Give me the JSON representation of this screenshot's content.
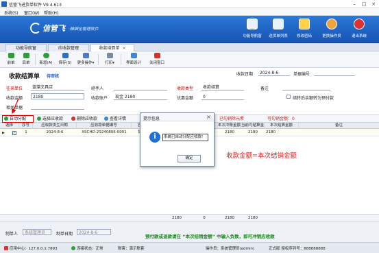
{
  "app": {
    "title": "信管飞进货单软件 V9.4.613",
    "window_controls": [
      "–",
      "□",
      "×"
    ]
  },
  "menu": [
    "系统(S)",
    "窗口(W)",
    "帮助(H)"
  ],
  "banner": {
    "brand": "信管飞",
    "slogan": "·精细化管理软件",
    "buttons": [
      {
        "label": "功能导航窗",
        "icon": "monitor-icon"
      },
      {
        "label": "送货单列表",
        "icon": "list-icon"
      },
      {
        "label": "修改密码",
        "icon": "lock-icon"
      },
      {
        "label": "更换操作员",
        "icon": "user-icon"
      },
      {
        "label": "退出系统",
        "icon": "exit-icon"
      }
    ],
    "colors": {
      "banner": "#1f66c9",
      "exit": "#e03030",
      "slogan": "#d9f0ff"
    }
  },
  "tabs": [
    {
      "label": "功能导航窗",
      "active": false
    },
    {
      "label": "应收款管理",
      "active": false
    },
    {
      "label": "收款结算单",
      "active": true,
      "close": "×"
    }
  ],
  "toolbar": [
    {
      "label": "前单",
      "icon": "arrow-left-icon"
    },
    {
      "label": "后单",
      "icon": "arrow-right-icon"
    },
    {
      "label": "新增(A)",
      "icon": "add-icon"
    },
    {
      "label": "保存(S)",
      "icon": "save-icon"
    },
    {
      "label": "更多操作",
      "icon": "more-icon",
      "dropdown": "▾"
    },
    {
      "label": "打印",
      "icon": "print-icon",
      "dropdown": "▾"
    },
    {
      "label": "界面设计",
      "icon": "design-icon"
    },
    {
      "label": "关闭窗口",
      "icon": "close-window-icon"
    }
  ],
  "form": {
    "title": "收款结算单",
    "status": "待审核",
    "date_label": "收款日期",
    "date_value": "2024-8-6",
    "docno_label": "单据编号",
    "docno_value": "",
    "customer_label": "往来单位",
    "customer_value": "蓝藻文具店",
    "handler_label": "经手人",
    "handler_value": "",
    "type_label": "收款类型",
    "type_value": "收款结算",
    "note_label": "备注",
    "note_value": "",
    "amount_label": "收款金额",
    "amount_value": "2180",
    "account_label": "收款账户",
    "account_value": "现金 2180",
    "discount_label": "优惠金额",
    "discount_value": "0",
    "checkbox_label": "结转后余额转为预付款",
    "attach_label": "相关单据",
    "attach_value": ""
  },
  "gridbar": {
    "auto_alloc": "自动分配",
    "select_receivable": "选择应收款",
    "delete_receivable": "删除应收款",
    "view_detail": "查看详情",
    "red_stat1": "已勾销除元素",
    "red_stat2": "可勾销金额：0"
  },
  "grid": {
    "columns": [
      "选择",
      "序号",
      "应收款发生日期",
      "应收款单据编号",
      "应收款类型",
      "",
      "",
      "本次冲账金额",
      "当前可结算金额",
      "本次结算金额",
      "备注"
    ],
    "rows": [
      {
        "selected": true,
        "seq": "1",
        "date": "2024-8-6",
        "docno": "XSCHD-20240806-0001",
        "type": "销售应收款",
        "c6": "",
        "c7": "2180",
        "c8": "2180",
        "c9": "2180",
        "c10": "2180",
        "note": ""
      }
    ],
    "footer": {
      "c6": "2180",
      "c7": "0",
      "c8": "2180",
      "c9": "2180"
    },
    "selected_mark": "▶",
    "check_mark": "✓"
  },
  "annotation": "收款金额=本次结销金额",
  "bottom": {
    "creator_label": "制单人",
    "creator_value": "系统管理员",
    "create_date_label": "制单日期",
    "create_date_value": "2024-8-6",
    "notice": "预付款或退款请在 “本次结销金额” 中输入负数，即可冲销应收款"
  },
  "statusbar": {
    "app_center": "应用中心：127.0.0.1:7893",
    "connection": "连接状态：正常",
    "account": "账套：演示账套",
    "operator": "操作员：系统管理员(admin)",
    "license": "正式版  授权序列号：888888888"
  },
  "dialog": {
    "title": "提示信息",
    "close": "×",
    "message": "系统已自动分配应收款!",
    "ok_label": "确定",
    "info_icon": "i"
  }
}
